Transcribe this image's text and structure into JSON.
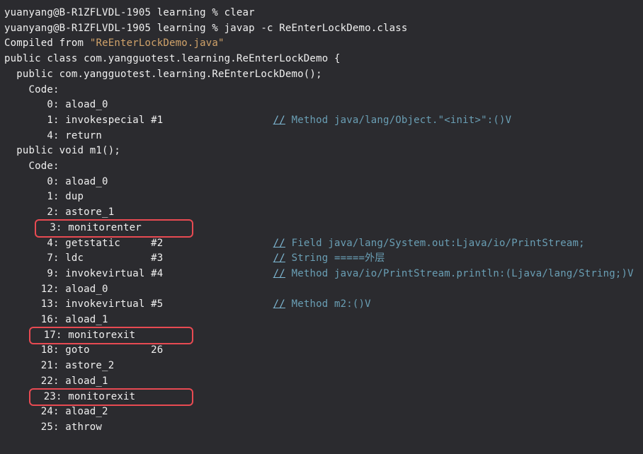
{
  "terminal": {
    "lines": [
      {
        "type": "plain",
        "text": "yuanyang@B-R1ZFLVDL-1905 learning % clear"
      },
      {
        "type": "plain",
        "text": "yuanyang@B-R1ZFLVDL-1905 learning % javap -c ReEnterLockDemo.class"
      },
      {
        "type": "compiled",
        "prefix": "Compiled from ",
        "quote": "\"ReEnterLockDemo.java\""
      },
      {
        "type": "plain",
        "text": "public class com.yangguotest.learning.ReEnterLockDemo {"
      },
      {
        "type": "plain",
        "text": "  public com.yangguotest.learning.ReEnterLockDemo();"
      },
      {
        "type": "plain",
        "text": "    Code:"
      },
      {
        "type": "plain",
        "text": "       0: aload_0"
      },
      {
        "type": "withcomment",
        "code": "       1: invokespecial #1                  ",
        "comment": "Method java/lang/Object.\"<init>\":()V"
      },
      {
        "type": "plain",
        "text": "       4: return"
      },
      {
        "type": "plain",
        "text": ""
      },
      {
        "type": "plain",
        "text": "  public void m1();"
      },
      {
        "type": "plain",
        "text": "    Code:"
      },
      {
        "type": "plain",
        "text": "       0: aload_0"
      },
      {
        "type": "plain",
        "text": "       1: dup"
      },
      {
        "type": "plain",
        "text": "       2: astore_1"
      },
      {
        "type": "highlighted",
        "prefix": "     ",
        "highlight": "  3: monitorenter        "
      },
      {
        "type": "withcomment",
        "code": "       4: getstatic     #2                  ",
        "comment": "Field java/lang/System.out:Ljava/io/PrintStream;"
      },
      {
        "type": "withcomment",
        "code": "       7: ldc           #3                  ",
        "comment": "String =====外层"
      },
      {
        "type": "withcomment",
        "code": "       9: invokevirtual #4                  ",
        "comment": "Method java/io/PrintStream.println:(Ljava/lang/String;)V"
      },
      {
        "type": "plain",
        "text": "      12: aload_0"
      },
      {
        "type": "withcomment",
        "code": "      13: invokevirtual #5                  ",
        "comment": "Method m2:()V"
      },
      {
        "type": "plain",
        "text": "      16: aload_1"
      },
      {
        "type": "highlighted",
        "prefix": "    ",
        "highlight": "  17: monitorexit         "
      },
      {
        "type": "plain",
        "text": "      18: goto          26"
      },
      {
        "type": "plain",
        "text": "      21: astore_2"
      },
      {
        "type": "plain",
        "text": "      22: aload_1"
      },
      {
        "type": "highlighted",
        "prefix": "    ",
        "highlight": "  23: monitorexit         "
      },
      {
        "type": "plain",
        "text": "      24: aload_2"
      },
      {
        "type": "plain",
        "text": "      25: athrow"
      }
    ]
  }
}
